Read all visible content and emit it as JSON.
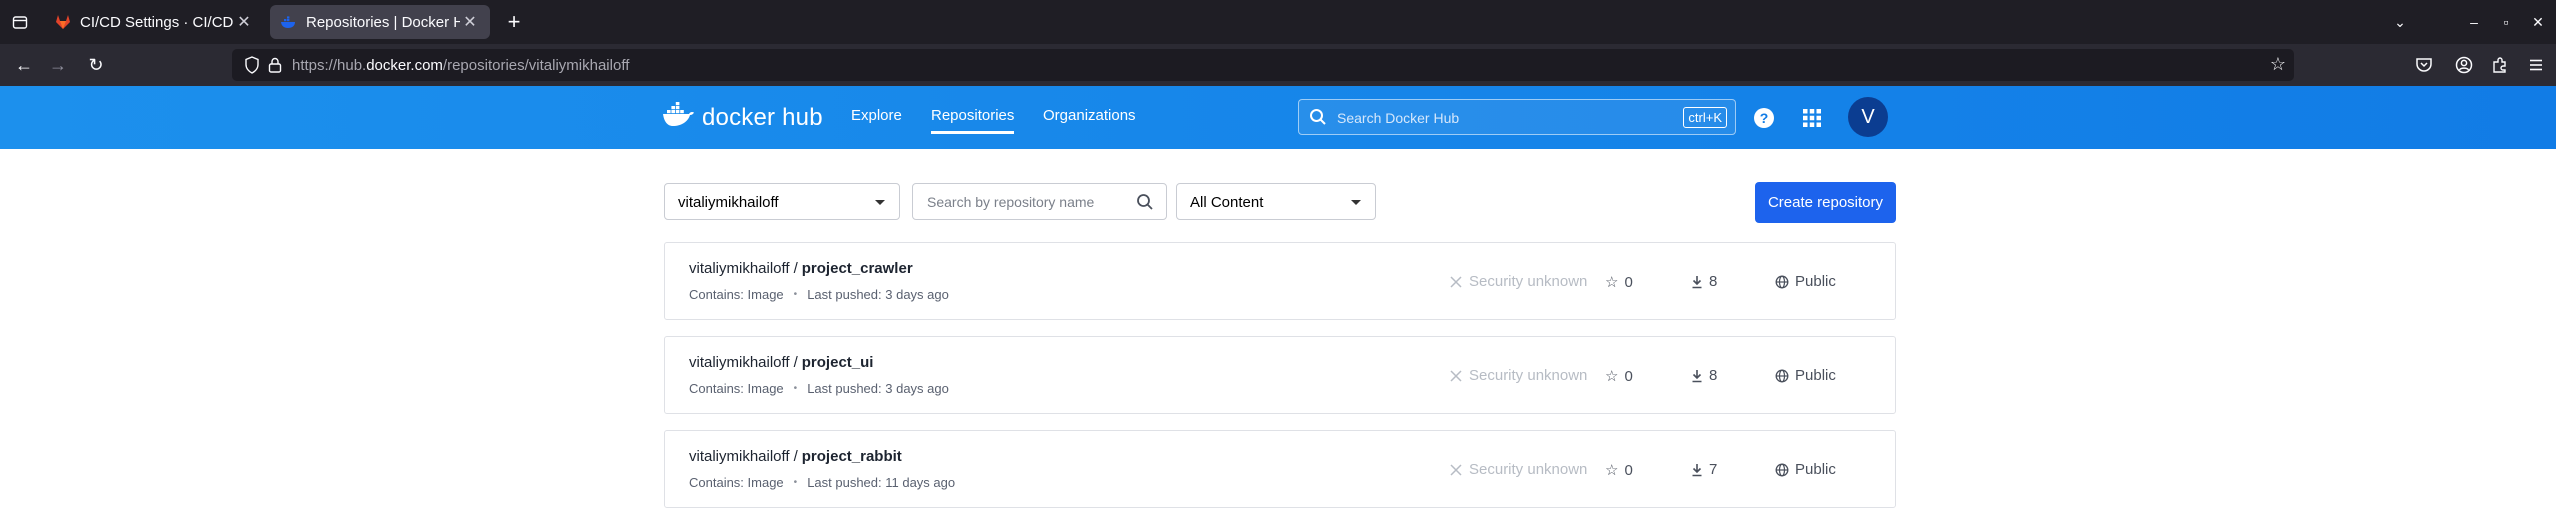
{
  "browser": {
    "tabs": [
      {
        "title": "CI/CD Settings · CI/CD · Se"
      },
      {
        "title": "Repositories | Docker Hub"
      }
    ],
    "url_prefix": "https://hub.",
    "url_domain": "docker.com",
    "url_path": "/repositories/vitaliymikhailoff"
  },
  "header": {
    "logo_text": "docker hub",
    "nav": [
      {
        "label": "Explore"
      },
      {
        "label": "Repositories"
      },
      {
        "label": "Organizations"
      }
    ],
    "search_placeholder": "Search Docker Hub",
    "search_shortcut": "ctrl+K",
    "avatar_initial": "V",
    "accent": "#117ce6"
  },
  "filters": {
    "namespace": "vitaliymikhailoff",
    "search_placeholder": "Search by repository name",
    "content_filter": "All Content",
    "create_label": "Create repository"
  },
  "repositories": [
    {
      "owner": "vitaliymikhailoff",
      "repo": "project_crawler",
      "contains": "Contains: Image",
      "pushed": "Last pushed: 3 days ago",
      "security": "Security unknown",
      "stars": "0",
      "pulls": "8",
      "visibility": "Public"
    },
    {
      "owner": "vitaliymikhailoff",
      "repo": "project_ui",
      "contains": "Contains: Image",
      "pushed": "Last pushed: 3 days ago",
      "security": "Security unknown",
      "stars": "0",
      "pulls": "8",
      "visibility": "Public"
    },
    {
      "owner": "vitaliymikhailoff",
      "repo": "project_rabbit",
      "contains": "Contains: Image",
      "pushed": "Last pushed: 11 days ago",
      "security": "Security unknown",
      "stars": "0",
      "pulls": "7",
      "visibility": "Public"
    }
  ]
}
